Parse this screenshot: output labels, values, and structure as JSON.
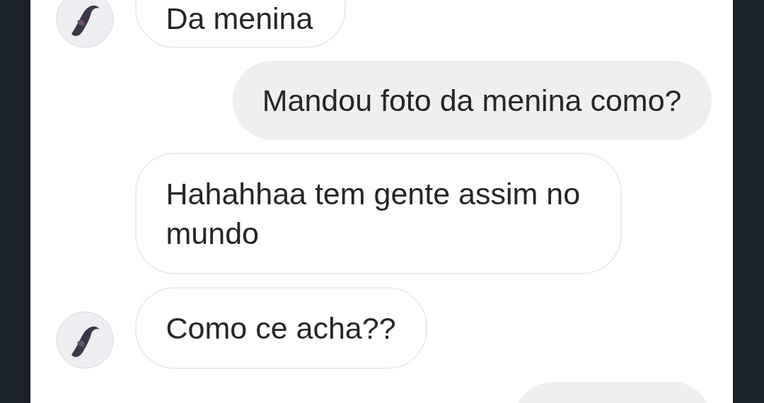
{
  "messages": [
    {
      "kind": "received",
      "text": "Da menina",
      "avatar": true
    },
    {
      "kind": "sent",
      "text": "Mandou foto da menina como?"
    },
    {
      "kind": "received",
      "text": "Hahahhaa tem gente assim no mundo",
      "avatar": false
    },
    {
      "kind": "received",
      "text": "Como ce acha??",
      "avatar": true
    },
    {
      "kind": "sent"
    }
  ]
}
